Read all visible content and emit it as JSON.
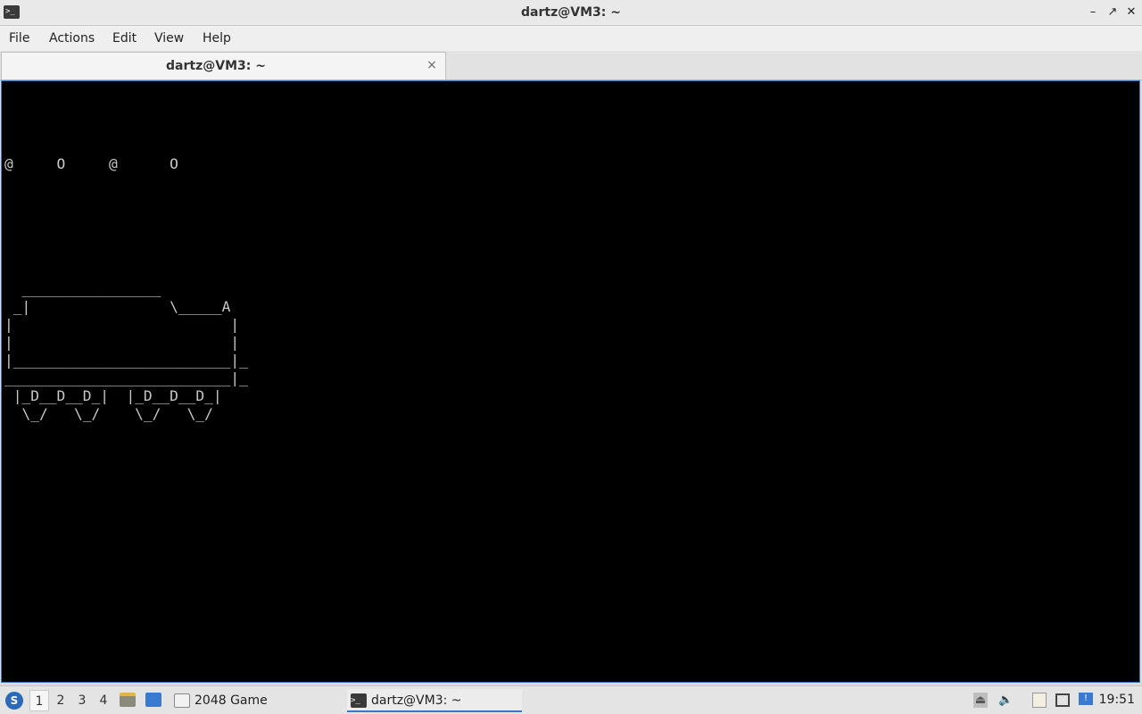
{
  "window": {
    "title": "dartz@VM3: ~",
    "app_icon": "terminal-icon"
  },
  "menu": {
    "items": [
      "File",
      "Actions",
      "Edit",
      "View",
      "Help"
    ]
  },
  "tab": {
    "label": "dartz@VM3: ~",
    "close_glyph": "×"
  },
  "terminal": {
    "output": "@     O     @      O\n\n\n\n\n\n\n  ________________\n _|                \\_____A\n|                         |\n|                         |\n|_________________________|_\n__________________________|_\n |_D__D__D_|  |_D__D__D_|\n  \\_/   \\_/    \\_/   \\_/"
  },
  "taskbar": {
    "desktops": [
      "1",
      "2",
      "3",
      "4"
    ],
    "active_desktop": "1",
    "tasks": [
      {
        "label": "2048 Game",
        "icon": "window-icon",
        "active": false
      },
      {
        "label": "dartz@VM3: ~",
        "icon": "terminal-icon",
        "active": true
      }
    ],
    "clock": "19:51"
  },
  "colors": {
    "terminal_bg": "#000000",
    "terminal_fg": "#c8c8c8",
    "accent": "#3b77c8"
  }
}
